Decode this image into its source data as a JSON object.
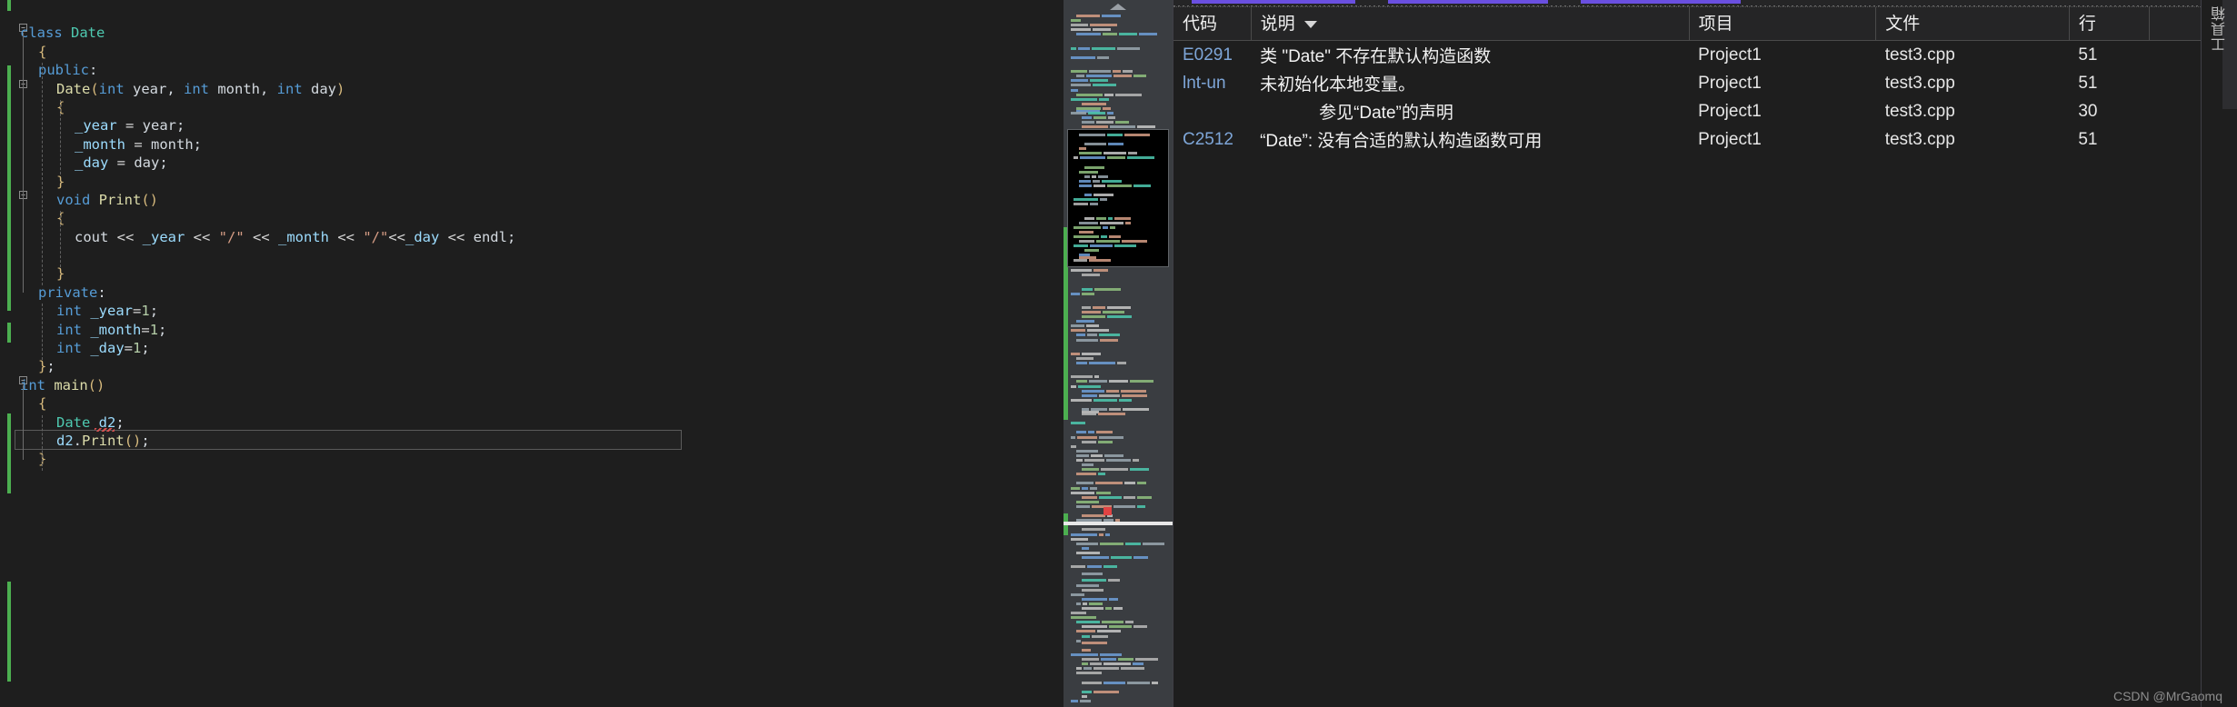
{
  "editor": {
    "language": "cpp",
    "lines": [
      {
        "indent": 0,
        "tokens": [],
        "fold": null
      },
      {
        "indent": 0,
        "fold": "minus",
        "tokens": [
          {
            "t": "class ",
            "c": "kw"
          },
          {
            "t": "Date",
            "c": "typ"
          }
        ]
      },
      {
        "indent": 1,
        "tokens": [
          {
            "t": "{",
            "c": "brc"
          }
        ]
      },
      {
        "indent": 1,
        "tokens": [
          {
            "t": "public",
            "c": "kw"
          },
          {
            "t": ":",
            "c": "plain"
          }
        ]
      },
      {
        "indent": 2,
        "fold": "minus",
        "tokens": [
          {
            "t": "Date",
            "c": "fn"
          },
          {
            "t": "(",
            "c": "brc"
          },
          {
            "t": "int",
            "c": "kw"
          },
          {
            "t": " year, ",
            "c": "plain"
          },
          {
            "t": "int",
            "c": "kw"
          },
          {
            "t": " month, ",
            "c": "plain"
          },
          {
            "t": "int",
            "c": "kw"
          },
          {
            "t": " day",
            "c": "plain"
          },
          {
            "t": ")",
            "c": "brc"
          }
        ]
      },
      {
        "indent": 2,
        "tokens": [
          {
            "t": "{",
            "c": "brc"
          }
        ]
      },
      {
        "indent": 3,
        "tokens": [
          {
            "t": "_year",
            "c": "var"
          },
          {
            "t": " = ",
            "c": "op"
          },
          {
            "t": "year",
            "c": "plain"
          },
          {
            "t": ";",
            "c": "plain"
          }
        ]
      },
      {
        "indent": 3,
        "tokens": [
          {
            "t": "_month",
            "c": "var"
          },
          {
            "t": " = ",
            "c": "op"
          },
          {
            "t": "month",
            "c": "plain"
          },
          {
            "t": ";",
            "c": "plain"
          }
        ]
      },
      {
        "indent": 3,
        "tokens": [
          {
            "t": "_day",
            "c": "var"
          },
          {
            "t": " = ",
            "c": "op"
          },
          {
            "t": "day",
            "c": "plain"
          },
          {
            "t": ";",
            "c": "plain"
          }
        ]
      },
      {
        "indent": 2,
        "tokens": [
          {
            "t": "}",
            "c": "brc"
          }
        ]
      },
      {
        "indent": 2,
        "fold": "minus",
        "tokens": [
          {
            "t": "void",
            "c": "kw"
          },
          {
            "t": " ",
            "c": "plain"
          },
          {
            "t": "Print",
            "c": "fn"
          },
          {
            "t": "()",
            "c": "brc"
          }
        ]
      },
      {
        "indent": 2,
        "tokens": [
          {
            "t": "{",
            "c": "brc"
          }
        ]
      },
      {
        "indent": 3,
        "tokens": [
          {
            "t": "cout",
            "c": "plain"
          },
          {
            "t": " << ",
            "c": "op"
          },
          {
            "t": "_year",
            "c": "var"
          },
          {
            "t": " << ",
            "c": "op"
          },
          {
            "t": "\"/\"",
            "c": "str"
          },
          {
            "t": " << ",
            "c": "op"
          },
          {
            "t": "_month",
            "c": "var"
          },
          {
            "t": " << ",
            "c": "op"
          },
          {
            "t": "\"/\"",
            "c": "str"
          },
          {
            "t": "<<",
            "c": "op"
          },
          {
            "t": "_day",
            "c": "var"
          },
          {
            "t": " << ",
            "c": "op"
          },
          {
            "t": "endl",
            "c": "plain"
          },
          {
            "t": ";",
            "c": "plain"
          }
        ]
      },
      {
        "indent": 3,
        "tokens": []
      },
      {
        "indent": 2,
        "tokens": [
          {
            "t": "}",
            "c": "brc"
          }
        ]
      },
      {
        "indent": 1,
        "tokens": [
          {
            "t": "private",
            "c": "kw"
          },
          {
            "t": ":",
            "c": "plain"
          }
        ]
      },
      {
        "indent": 2,
        "tokens": [
          {
            "t": "int",
            "c": "kw"
          },
          {
            "t": " ",
            "c": "plain"
          },
          {
            "t": "_year",
            "c": "var"
          },
          {
            "t": "=",
            "c": "op"
          },
          {
            "t": "1",
            "c": "num"
          },
          {
            "t": ";",
            "c": "plain"
          }
        ]
      },
      {
        "indent": 2,
        "tokens": [
          {
            "t": "int",
            "c": "kw"
          },
          {
            "t": " ",
            "c": "plain"
          },
          {
            "t": "_month",
            "c": "var"
          },
          {
            "t": "=",
            "c": "op"
          },
          {
            "t": "1",
            "c": "num"
          },
          {
            "t": ";",
            "c": "plain"
          }
        ]
      },
      {
        "indent": 2,
        "tokens": [
          {
            "t": "int",
            "c": "kw"
          },
          {
            "t": " ",
            "c": "plain"
          },
          {
            "t": "_day",
            "c": "var"
          },
          {
            "t": "=",
            "c": "op"
          },
          {
            "t": "1",
            "c": "num"
          },
          {
            "t": ";",
            "c": "plain"
          }
        ]
      },
      {
        "indent": 1,
        "tokens": [
          {
            "t": "}",
            "c": "brc"
          },
          {
            "t": ";",
            "c": "plain"
          }
        ]
      },
      {
        "indent": 0,
        "fold": "minus",
        "tokens": [
          {
            "t": "int",
            "c": "kw"
          },
          {
            "t": " ",
            "c": "plain"
          },
          {
            "t": "main",
            "c": "fn"
          },
          {
            "t": "()",
            "c": "brc"
          }
        ]
      },
      {
        "indent": 1,
        "tokens": [
          {
            "t": "{",
            "c": "brc"
          }
        ]
      },
      {
        "indent": 2,
        "tokens": [
          {
            "t": "Date",
            "c": "typ"
          },
          {
            "t": " ",
            "c": "plain"
          },
          {
            "t": "d2",
            "c": "var"
          },
          {
            "t": ";",
            "c": "plain"
          }
        ]
      },
      {
        "indent": 2,
        "current": true,
        "tokens": [
          {
            "t": "d2",
            "c": "var"
          },
          {
            "t": ".",
            "c": "plain"
          },
          {
            "t": "Print",
            "c": "fn"
          },
          {
            "t": "()",
            "c": "brc"
          },
          {
            "t": ";",
            "c": "plain"
          }
        ]
      },
      {
        "indent": 1,
        "tokens": [
          {
            "t": "}",
            "c": "brc"
          }
        ]
      }
    ]
  },
  "error_list": {
    "columns": [
      {
        "key": "code",
        "label": "代码",
        "sorted": false
      },
      {
        "key": "description",
        "label": "说明",
        "sorted": true
      },
      {
        "key": "project",
        "label": "项目",
        "sorted": false
      },
      {
        "key": "file",
        "label": "文件",
        "sorted": false
      },
      {
        "key": "line",
        "label": "行",
        "sorted": false
      },
      {
        "key": "blank",
        "label": "",
        "sorted": false
      }
    ],
    "rows": [
      {
        "code": "E0291",
        "description": "类 \"Date\" 不存在默认构造函数",
        "project": "Project1",
        "file": "test3.cpp",
        "line": "51",
        "indent": false
      },
      {
        "code": "lnt-un",
        "description": "未初始化本地变量。",
        "project": "Project1",
        "file": "test3.cpp",
        "line": "51",
        "indent": false
      },
      {
        "code": "",
        "description": "参见“Date”的声明",
        "project": "Project1",
        "file": "test3.cpp",
        "line": "30",
        "indent": true
      },
      {
        "code": "C2512",
        "description": "“Date”: 没有合适的默认构造函数可用",
        "project": "Project1",
        "file": "test3.cpp",
        "line": "51",
        "indent": false
      }
    ]
  },
  "toolbox": {
    "tab_label": "工具箱"
  },
  "watermark": {
    "text": "CSDN @MrGaomq"
  },
  "colors": {
    "editor_bg": "#1e1e1e",
    "minimap_bg": "#3a3d41",
    "change_bar_green": "#4caf50",
    "error_blue": "#7ea6d8",
    "accent_purple": "#6a4fe0",
    "squiggle_red": "#e05252"
  }
}
